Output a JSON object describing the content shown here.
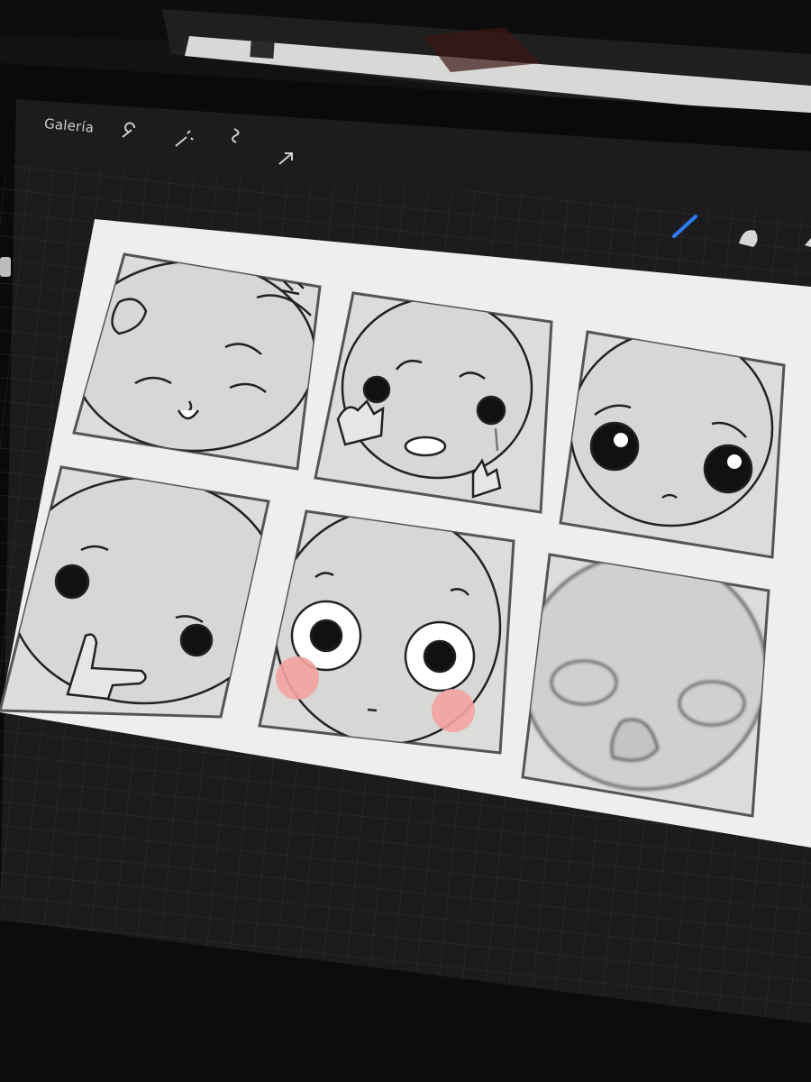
{
  "app": {
    "gallery_label": "Galería"
  },
  "toolbar_left": [
    {
      "icon": "wrench-icon"
    },
    {
      "icon": "magic-wand-icon"
    },
    {
      "icon": "selection-icon"
    },
    {
      "icon": "transform-arrow-icon"
    }
  ],
  "toolbar_right": [
    {
      "icon": "brush-icon",
      "color": "#2f7bf5"
    },
    {
      "icon": "smudge-icon"
    },
    {
      "icon": "eraser-icon"
    }
  ],
  "canvas": {
    "panels": [
      {
        "expression": "embarrassed-tongue-out"
      },
      {
        "expression": "crying"
      },
      {
        "expression": "worried"
      },
      {
        "expression": "pointing-dizzy"
      },
      {
        "expression": "shocked-blush"
      },
      {
        "expression": "blurred-face"
      }
    ],
    "blush_color": "#f2a3a0"
  },
  "colors": {
    "ui_background": "#1c1c1e",
    "accent": "#2f7bf5",
    "canvas": "#eeeeec"
  }
}
